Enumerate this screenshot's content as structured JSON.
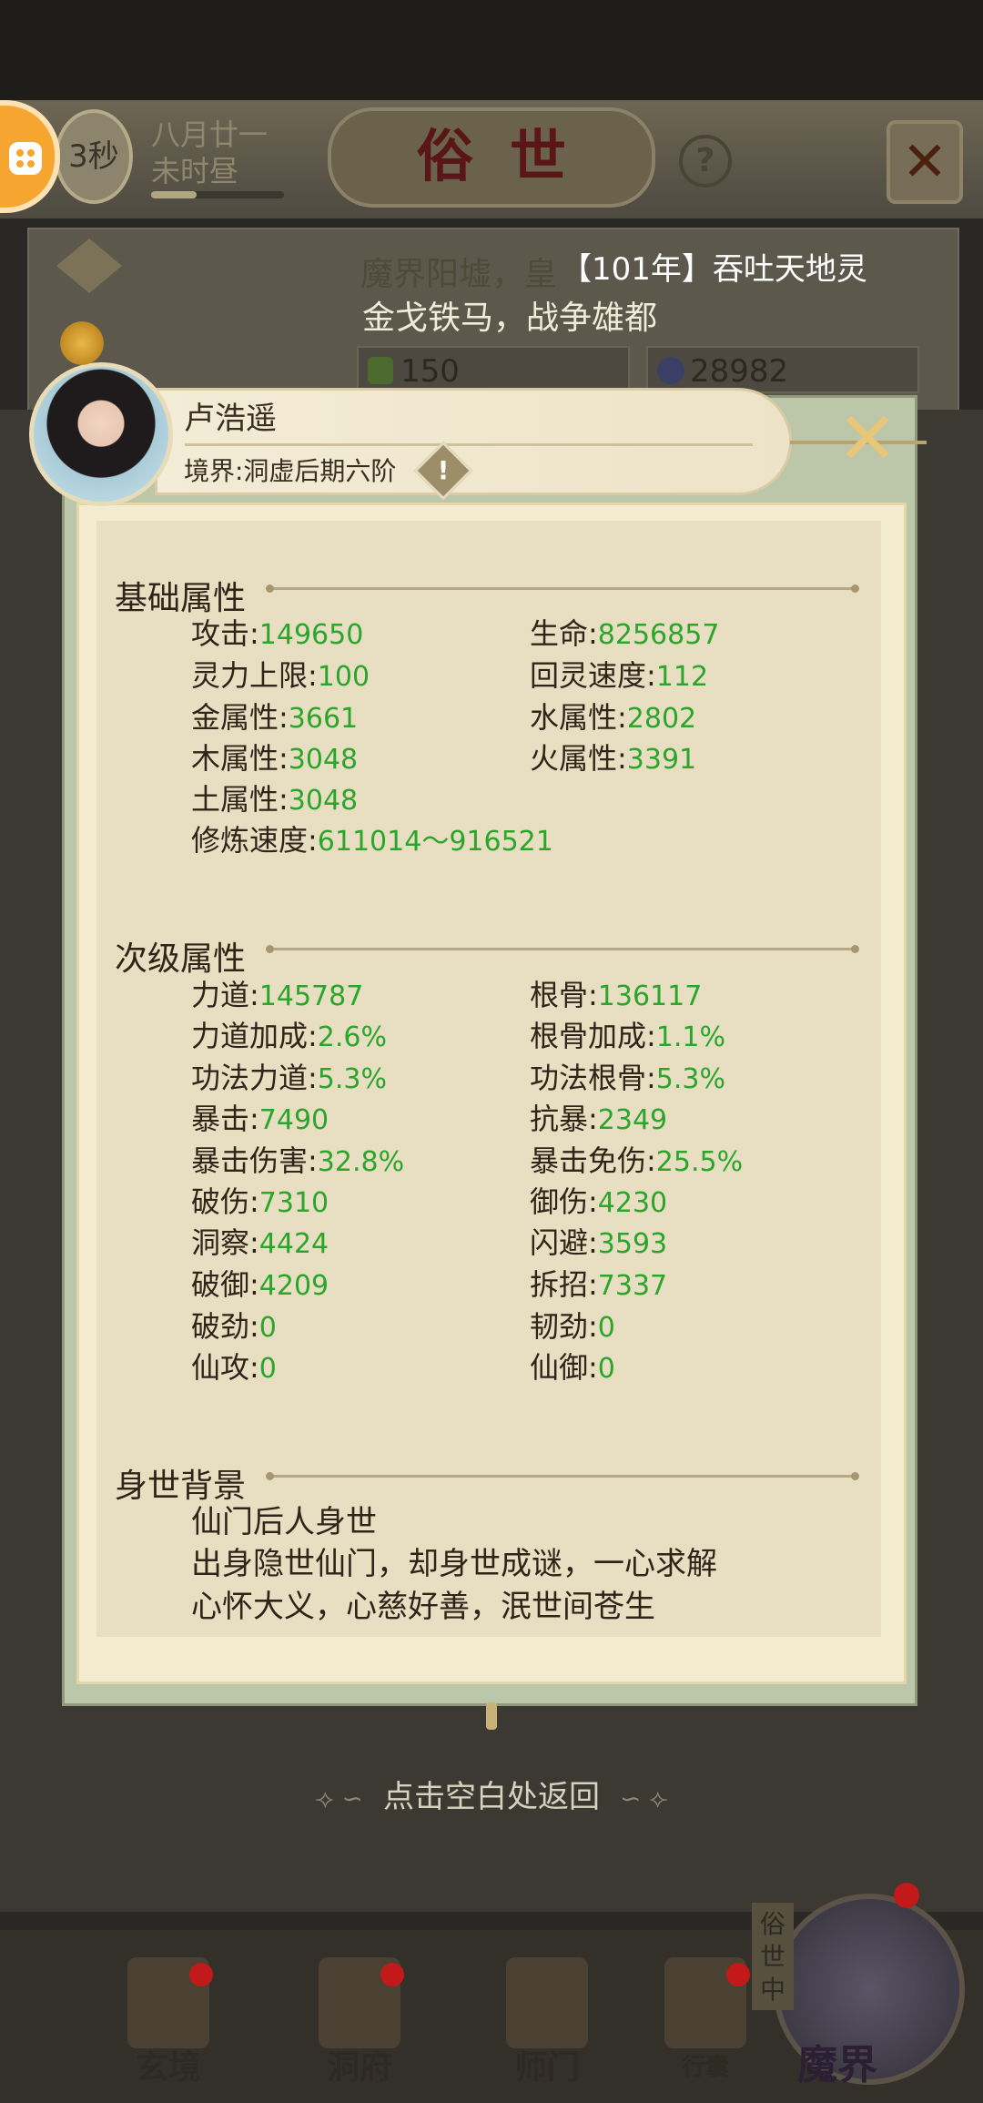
{
  "top_bar": {
    "timer": "3秒",
    "date_line1": "八月廿一",
    "date_line2": "未时昼",
    "title": "俗世",
    "help": "?"
  },
  "background_event": {
    "text1": "魔界阳墟，皇",
    "event_title": "【101年】吞吐天地灵",
    "text2": "金戈铁马，战争雄都",
    "resource1": "150",
    "resource2": "28982"
  },
  "character": {
    "name": "卢浩遥",
    "realm": "境界:洞虚后期六阶"
  },
  "sections": {
    "basic_title": "基础属性",
    "secondary_title": "次级属性",
    "background_title": "身世背景"
  },
  "basic_stats": [
    {
      "label": "攻击:",
      "value": "149650"
    },
    {
      "label": "生命:",
      "value": "8256857"
    },
    {
      "label": "灵力上限:",
      "value": "100"
    },
    {
      "label": "回灵速度:",
      "value": "112"
    },
    {
      "label": "金属性:",
      "value": "3661"
    },
    {
      "label": "水属性:",
      "value": "2802"
    },
    {
      "label": "木属性:",
      "value": "3048"
    },
    {
      "label": "火属性:",
      "value": "3391"
    },
    {
      "label": "土属性:",
      "value": "3048"
    },
    {
      "label": "修炼速度:",
      "value": "611014～916521"
    }
  ],
  "secondary_stats": [
    {
      "label": "力道:",
      "value": "145787"
    },
    {
      "label": "根骨:",
      "value": "136117"
    },
    {
      "label": "力道加成:",
      "value": "2.6%"
    },
    {
      "label": "根骨加成:",
      "value": "1.1%"
    },
    {
      "label": "功法力道:",
      "value": "5.3%"
    },
    {
      "label": "功法根骨:",
      "value": "5.3%"
    },
    {
      "label": "暴击:",
      "value": "7490"
    },
    {
      "label": "抗暴:",
      "value": "2349"
    },
    {
      "label": "暴击伤害:",
      "value": "32.8%"
    },
    {
      "label": "暴击免伤:",
      "value": "25.5%"
    },
    {
      "label": "破伤:",
      "value": "7310"
    },
    {
      "label": "御伤:",
      "value": "4230"
    },
    {
      "label": "洞察:",
      "value": "4424"
    },
    {
      "label": "闪避:",
      "value": "3593"
    },
    {
      "label": "破御:",
      "value": "4209"
    },
    {
      "label": "拆招:",
      "value": "7337"
    },
    {
      "label": "破劲:",
      "value": "0"
    },
    {
      "label": "韧劲:",
      "value": "0"
    },
    {
      "label": "仙攻:",
      "value": "0"
    },
    {
      "label": "仙御:",
      "value": "0"
    }
  ],
  "background_lines": [
    "仙门后人身世",
    "出身隐世仙门，却身世成谜，一心求解",
    "心怀大义，心慈好善，泯世间苍生"
  ],
  "return_hint": "点击空白处返回",
  "bottom_nav": {
    "item1": "玄境",
    "item2": "洞府",
    "item3": "师门",
    "item4": "行囊",
    "moshi_tag": "俗世中",
    "moshi": "魔界"
  },
  "colors": {
    "stat_value": "#2ba52b",
    "text": "#2e2418",
    "panel": "#e8dfc3",
    "title_red": "#5a1616"
  }
}
